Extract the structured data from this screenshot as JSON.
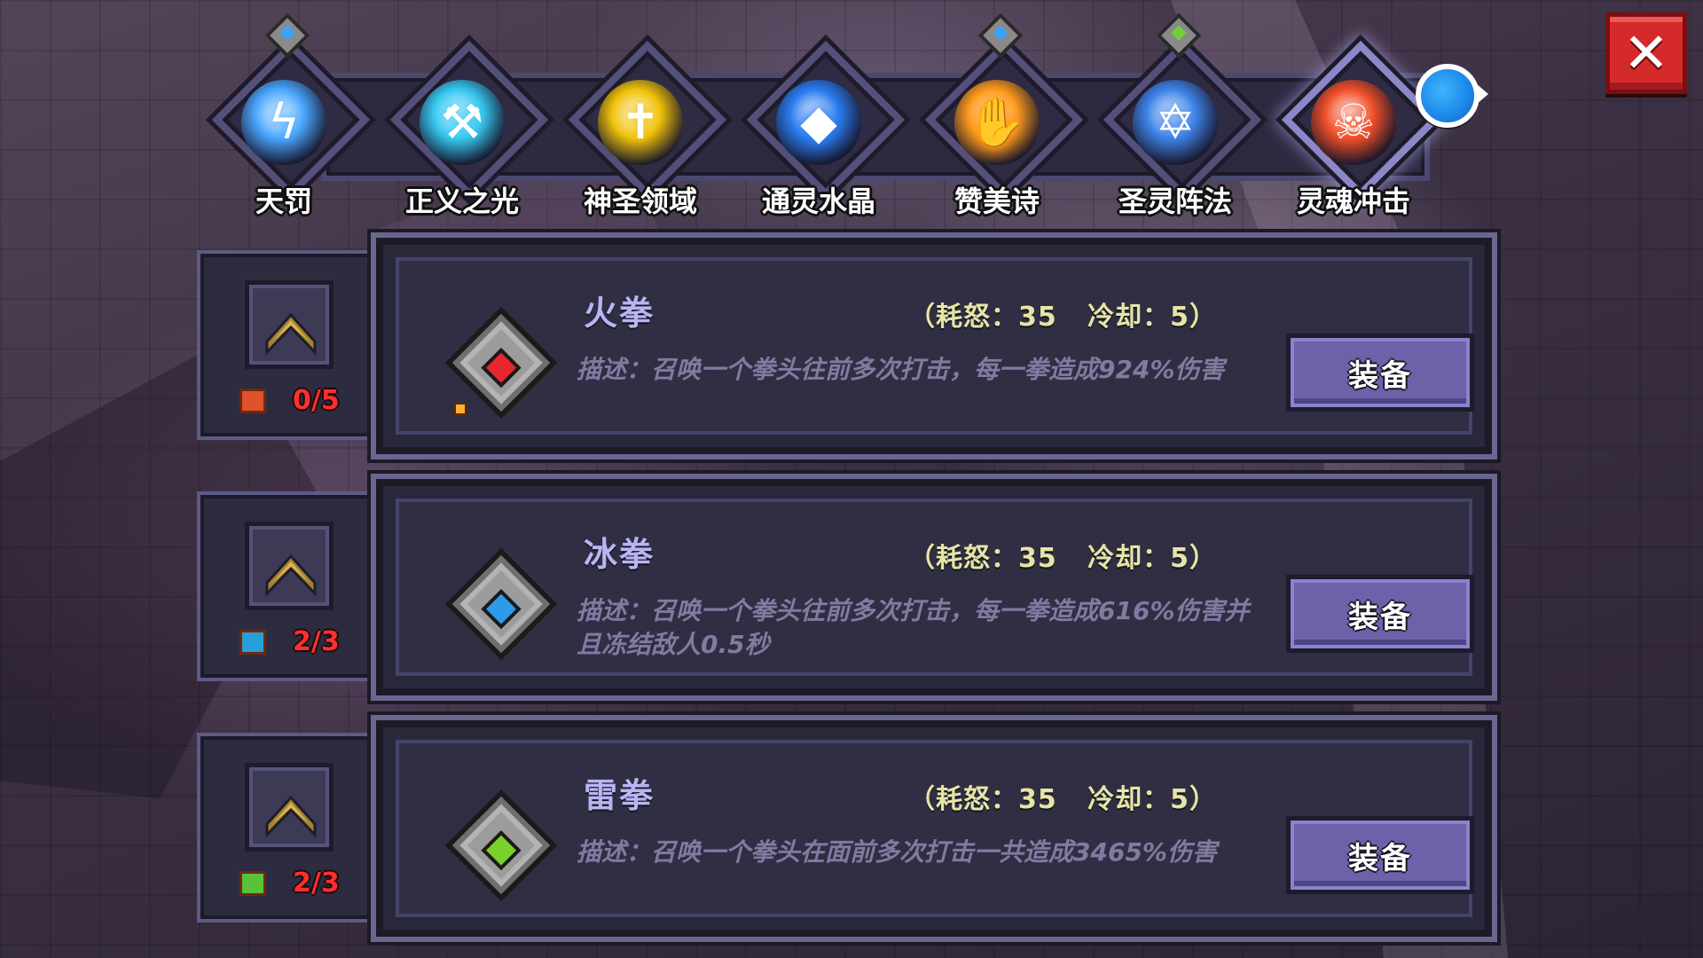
{
  "close_button": {
    "label": "✕",
    "color": "#d52a2a"
  },
  "skill_tabs": [
    {
      "name": "天罚",
      "icon": "lightning-swirl-icon",
      "orb_color": "#4aa8ff",
      "gem_color": "#3aa2ff",
      "has_gem": true,
      "active": false
    },
    {
      "name": "正义之光",
      "icon": "hammer-icon",
      "orb_color": "#38c8f0",
      "gem_color": "",
      "has_gem": false,
      "active": false
    },
    {
      "name": "神圣领域",
      "icon": "holy-cross-icon",
      "orb_color": "#f0c20a",
      "gem_color": "",
      "has_gem": false,
      "active": false
    },
    {
      "name": "通灵水晶",
      "icon": "crystal-icon",
      "orb_color": "#2b7cf0",
      "gem_color": "",
      "has_gem": false,
      "active": false
    },
    {
      "name": "赞美诗",
      "icon": "flame-hand-icon",
      "orb_color": "#ff9a1e",
      "gem_color": "#3aa2ff",
      "has_gem": true,
      "active": false
    },
    {
      "name": "圣灵阵法",
      "icon": "hexagram-icon",
      "orb_color": "#3f83e8",
      "gem_color": "#6fd136",
      "has_gem": true,
      "active": false
    },
    {
      "name": "灵魂冲击",
      "icon": "soul-skull-icon",
      "orb_color": "#f0502a",
      "gem_color": "",
      "has_gem": false,
      "active": true
    }
  ],
  "skills": [
    {
      "title": "火拳",
      "stats": "（耗怒：35   冷却：5）",
      "description": "描述：召唤一个拳头往前多次打击，每一拳造成924%伤害",
      "equip_label": "装备",
      "element_color": "#e8262e",
      "book_color": "#e0522a",
      "upgrade_count": "0/5",
      "has_spark": true
    },
    {
      "title": "冰拳",
      "stats": "（耗怒：35   冷却：5）",
      "description": "描述：召唤一个拳头往前多次打击，每一拳造成616%伤害并且冻结敌人0.5秒",
      "equip_label": "装备",
      "element_color": "#2c9be8",
      "book_color": "#2a9ed8",
      "upgrade_count": "2/3",
      "has_spark": false
    },
    {
      "title": "雷拳",
      "stats": "（耗怒：35   冷却：5）",
      "description": "描述：召唤一个拳头在面前多次打击一共造成3465%伤害",
      "equip_label": "装备",
      "element_color": "#7ad12a",
      "book_color": "#58c23a",
      "upgrade_count": "2/3",
      "has_spark": false
    }
  ]
}
